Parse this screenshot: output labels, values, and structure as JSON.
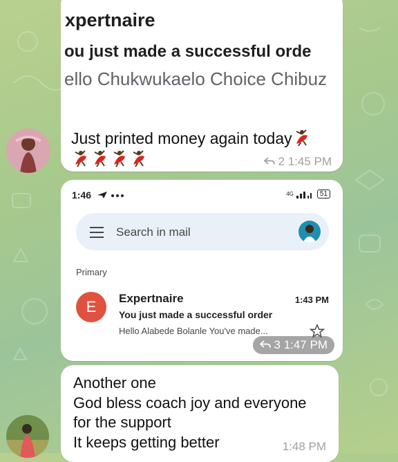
{
  "messages": [
    {
      "email_screenshot": {
        "sender": "xpertnaire",
        "subject": "ou just made a successful orde",
        "preview": "ello Chukwukaelo Choice Chibuz"
      },
      "caption": "Just printed money again today",
      "emoji": "dancer",
      "replies": "2",
      "time": "1:45 PM"
    },
    {
      "phone_status": {
        "time": "1:46",
        "network": "4G",
        "battery": "51"
      },
      "gmail": {
        "search_placeholder": "Search in mail",
        "section_label": "Primary",
        "email": {
          "avatar_letter": "E",
          "sender": "Expertnaire",
          "time": "1:43 PM",
          "subject": "You just made a successful order",
          "preview": "Hello Alabede Bolanle You've made..."
        }
      },
      "replies": "3",
      "time": "1:47 PM"
    },
    {
      "lines": [
        "Another one",
        "God bless coach joy and everyone",
        "for the support",
        "It keeps getting better"
      ],
      "time": "1:48 PM"
    }
  ],
  "colors": {
    "background": "#a7c98d",
    "bubble": "#ffffff",
    "gmail_avatar": "#e0523f",
    "meta_text": "#9aa39a"
  },
  "icons": [
    "reply-icon",
    "send-arrow-icon",
    "more-dots-icon",
    "hamburger-menu-icon",
    "star-icon",
    "signal-icon",
    "battery-icon",
    "dancer-emoji"
  ]
}
